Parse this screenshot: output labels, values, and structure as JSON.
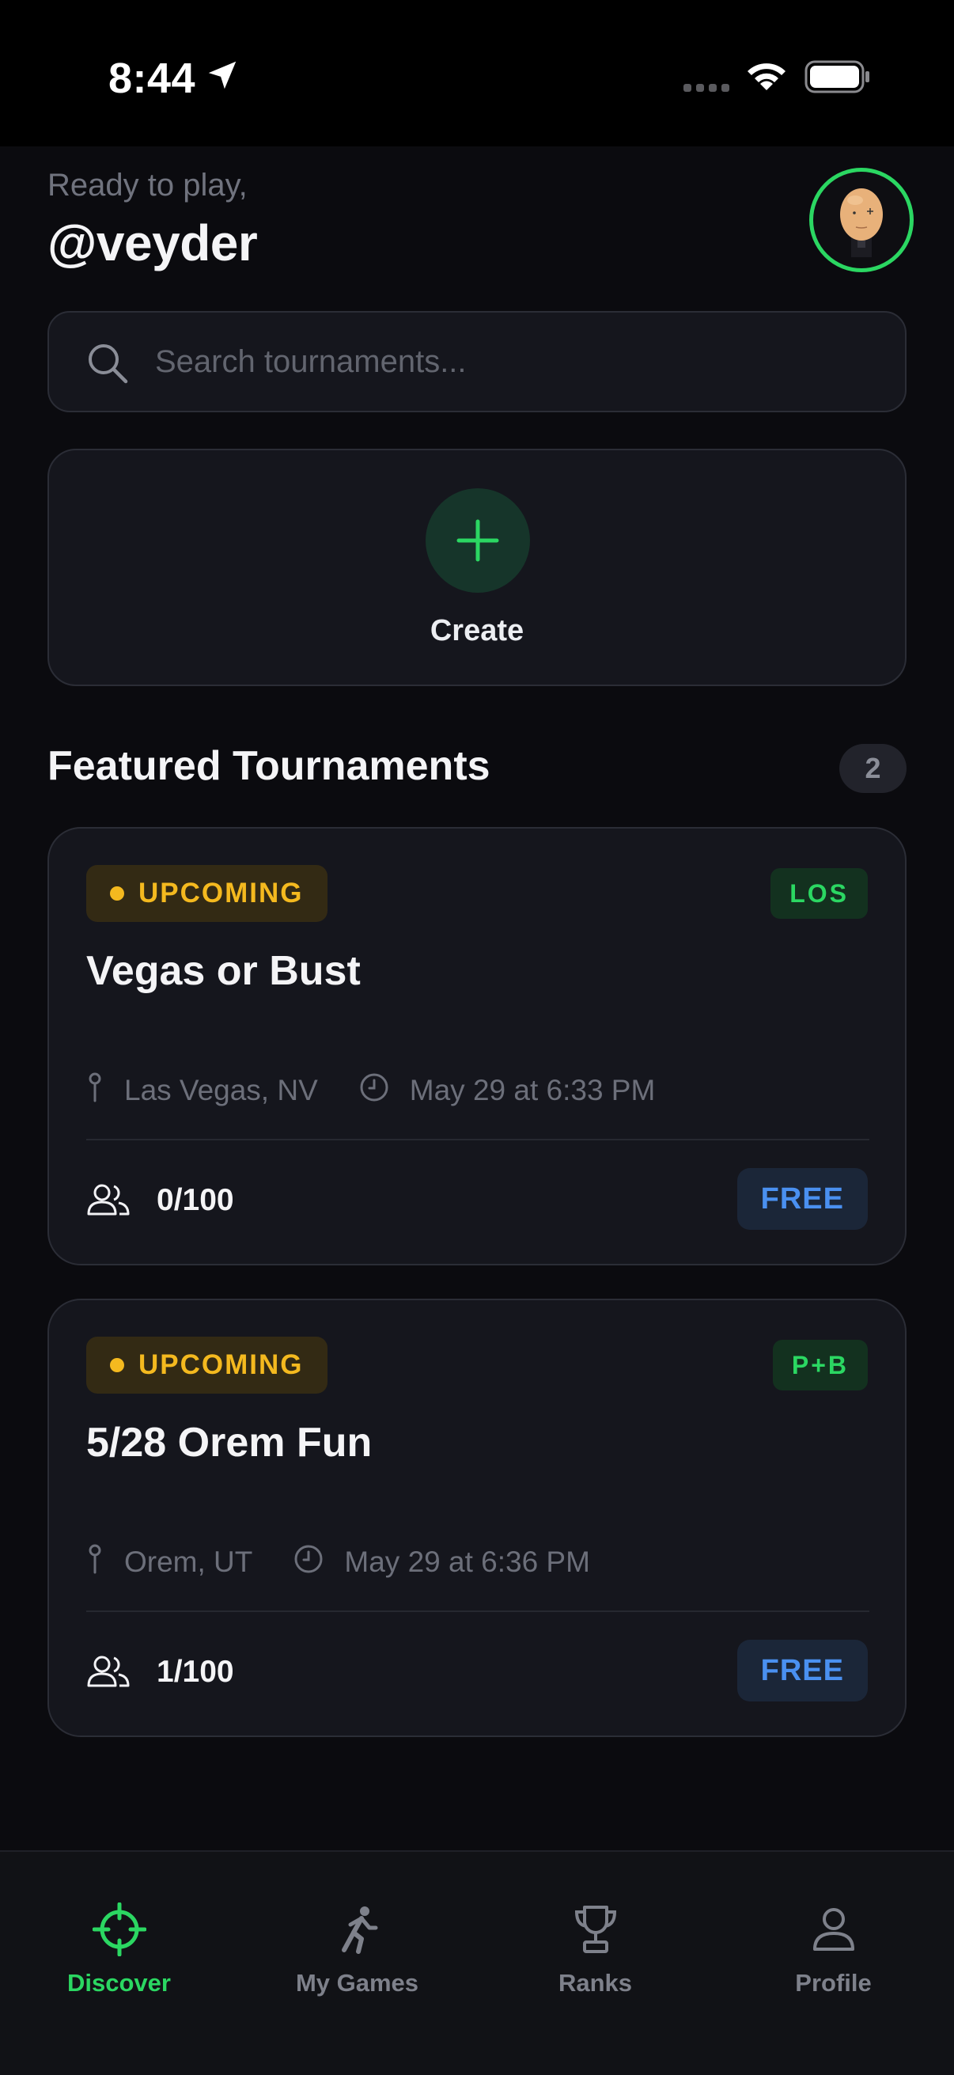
{
  "status_bar": {
    "time": "8:44"
  },
  "header": {
    "greeting": "Ready to play,",
    "username": "@veyder"
  },
  "search": {
    "placeholder": "Search tournaments..."
  },
  "create": {
    "label": "Create"
  },
  "featured": {
    "title": "Featured Tournaments",
    "count": "2",
    "tournaments": [
      {
        "status": "UPCOMING",
        "code": "LOS",
        "name": "Vegas or Bust",
        "location": "Las Vegas, NV",
        "datetime": "May 29 at 6:33 PM",
        "players": "0/100",
        "price": "FREE"
      },
      {
        "status": "UPCOMING",
        "code": "P+B",
        "name": "5/28 Orem Fun",
        "location": "Orem, UT",
        "datetime": "May 29 at 6:36 PM",
        "players": "1/100",
        "price": "FREE"
      }
    ]
  },
  "tabbar": {
    "items": [
      {
        "label": "Discover",
        "icon": "crosshair-icon",
        "active": true
      },
      {
        "label": "My Games",
        "icon": "running-person-icon",
        "active": false
      },
      {
        "label": "Ranks",
        "icon": "trophy-icon",
        "active": false
      },
      {
        "label": "Profile",
        "icon": "person-icon",
        "active": false
      }
    ]
  },
  "colors": {
    "accent": "#2bd762",
    "upcoming": "#f4b91f",
    "price": "#4a90f0",
    "background": "#0b0b0f",
    "card": "#15161d"
  }
}
